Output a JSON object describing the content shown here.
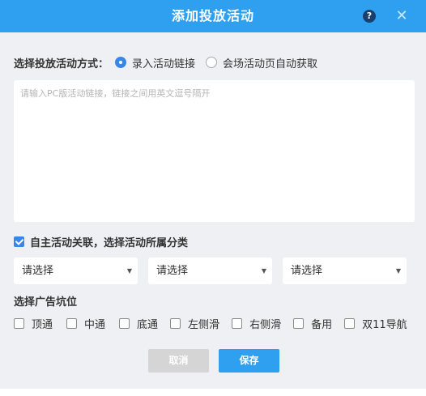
{
  "dialog": {
    "title": "添加投放活动",
    "help_glyph": "?",
    "close_glyph": "✕"
  },
  "mode": {
    "label": "选择投放活动方式：",
    "options": [
      {
        "label": "录入活动链接",
        "selected": true
      },
      {
        "label": "会场活动页自动获取",
        "selected": false
      }
    ]
  },
  "links_input": {
    "placeholder": "请输入PC版活动链接，链接之间用英文逗号隔开",
    "value": ""
  },
  "auto_link": {
    "label": "自主活动关联，选择活动所属分类",
    "checked": true
  },
  "category_selects": [
    {
      "value": "请选择"
    },
    {
      "value": "请选择"
    },
    {
      "value": "请选择"
    }
  ],
  "slots": {
    "label": "选择广告坑位",
    "options": [
      {
        "label": "顶通",
        "checked": false
      },
      {
        "label": "中通",
        "checked": false
      },
      {
        "label": "底通",
        "checked": false
      },
      {
        "label": "左侧滑",
        "checked": false
      },
      {
        "label": "右侧滑",
        "checked": false
      },
      {
        "label": "备用",
        "checked": false
      },
      {
        "label": "双11导航",
        "checked": false
      }
    ]
  },
  "buttons": {
    "cancel": "取消",
    "save": "保存"
  },
  "colors": {
    "header": "#2fa0ef",
    "accent": "#3a86e8",
    "body_bg": "#eef0f3",
    "cancel_bg": "#d5d5d5"
  }
}
